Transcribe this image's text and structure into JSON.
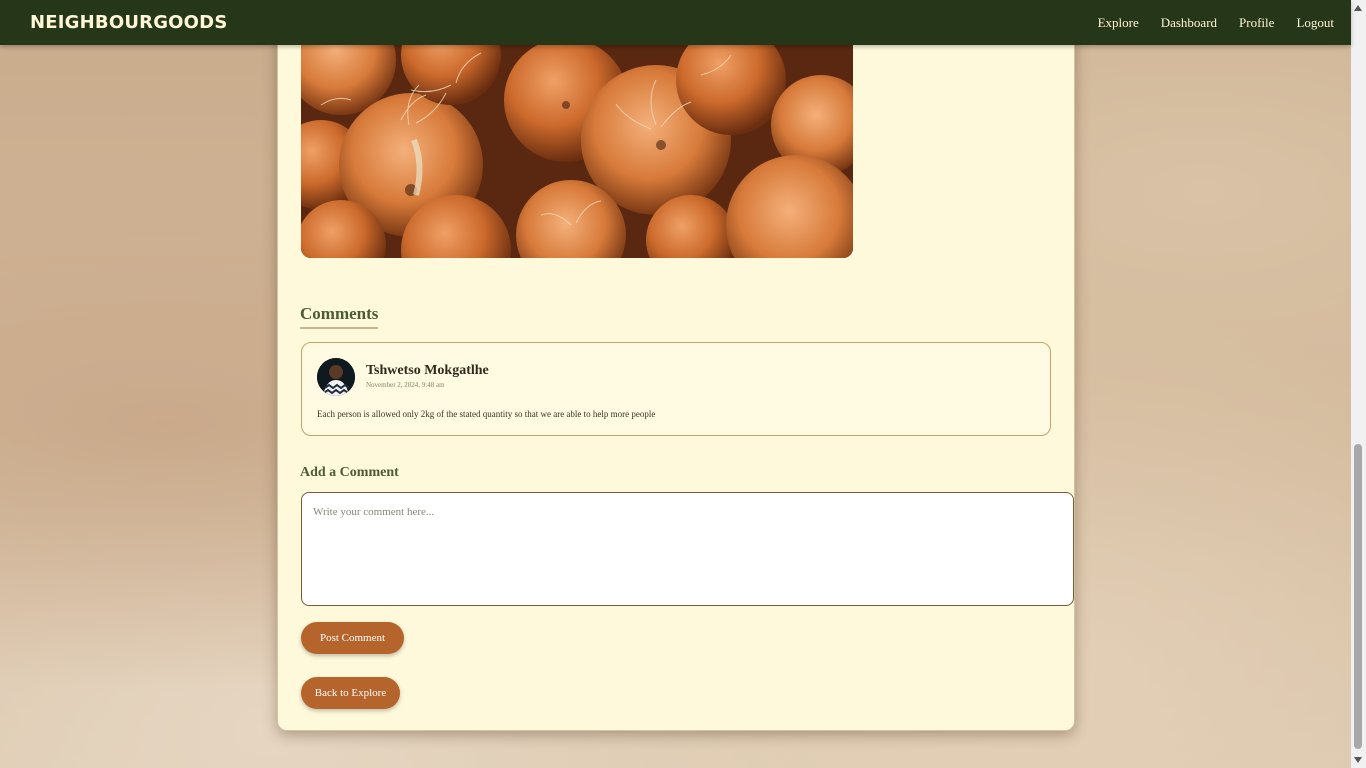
{
  "navbar": {
    "brand": "NEIGHBOURGOODS",
    "links": [
      "Explore",
      "Dashboard",
      "Profile",
      "Logout"
    ]
  },
  "post": {
    "image_alt": "onions"
  },
  "comments": {
    "title": "Comments",
    "items": [
      {
        "author": "Tshwetso Mokgatlhe",
        "timestamp": "November 2, 2024, 9:48 am",
        "text": "Each person is allowed only 2kg of the stated quantity so that we are able to help more people"
      }
    ]
  },
  "add_comment": {
    "title": "Add a Comment",
    "placeholder": "Write your comment here...",
    "value": "",
    "submit_label": "Post Comment"
  },
  "back_label": "Back to Explore",
  "colors": {
    "navbar": "#263618",
    "accent": "#b5652b",
    "card": "#fff9dc"
  }
}
